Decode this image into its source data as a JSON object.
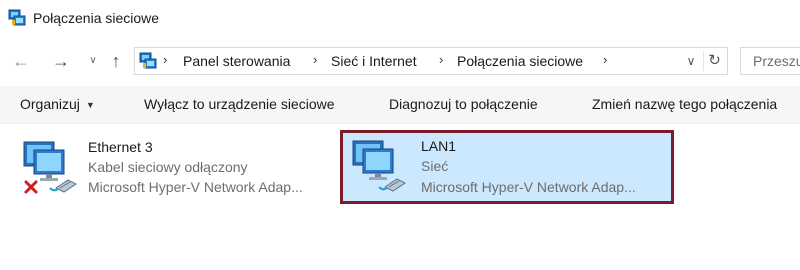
{
  "window": {
    "title": "Połączenia sieciowe"
  },
  "nav": {
    "back_icon": "arrow-left-icon",
    "forward_icon": "arrow-right-icon",
    "recent_icon": "chevron-down-icon",
    "up_icon": "arrow-up-icon"
  },
  "address": {
    "breadcrumbs": [
      "Panel sterowania",
      "Sieć i Internet",
      "Połączenia sieciowe"
    ],
    "search_placeholder": "Przeszukaj"
  },
  "commands": {
    "organize": "Organizuj",
    "disable": "Wyłącz to urządzenie sieciowe",
    "diagnose": "Diagnozuj to połączenie",
    "rename": "Zmień nazwę tego połączenia"
  },
  "connections": [
    {
      "name": "Ethernet 3",
      "status": "Kabel sieciowy odłączony",
      "device": "Microsoft Hyper-V Network Adap...",
      "disconnected": true,
      "selected": false
    },
    {
      "name": "LAN1",
      "status": "Sieć",
      "device": "Microsoft Hyper-V Network Adap...",
      "disconnected": false,
      "selected": true
    }
  ],
  "colors": {
    "selection_bg": "#cce8ff",
    "selection_border": "#7a1c2b",
    "error_red": "#d11c1c"
  }
}
